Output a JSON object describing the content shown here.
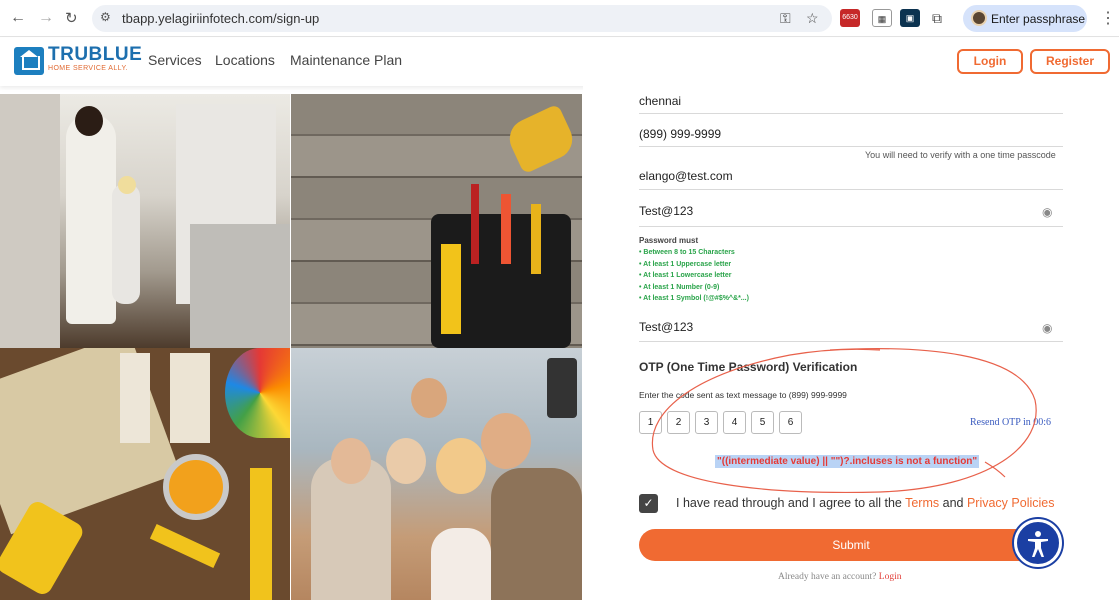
{
  "browser": {
    "url": "tbapp.yelagiriinfotech.com/sign-up",
    "profile_button": "Enter passphrase",
    "extension_badge": "6630"
  },
  "header": {
    "logo_name": "TRUBLUE",
    "logo_tagline": "HOME SERVICE ALLY.",
    "nav": [
      "Services",
      "Locations",
      "Maintenance Plan"
    ],
    "login_label": "Login",
    "register_label": "Register"
  },
  "form": {
    "city_value": "chennai",
    "phone_value": "(899) 999-9999",
    "phone_hint": "You will need to verify with a one time passcode",
    "email_value": "elango@test.com",
    "password_value": "Test@123",
    "password_rules_title": "Password must",
    "password_rules": [
      "• Between 8 to 15 Characters",
      "• At least 1 Uppercase letter",
      "• At least 1 Lowercase letter",
      "• At least 1 Number (0-9)",
      "• At least 1 Symbol (!@#$%^&*...)"
    ],
    "confirm_password_value": "Test@123",
    "otp_title": "OTP (One Time Password) Verification",
    "otp_subtitle": "Enter the code sent as text message to (899) 999-9999",
    "otp_digits": [
      "1",
      "2",
      "3",
      "4",
      "5",
      "6"
    ],
    "resend_label": "Resend OTP in 00:6",
    "error_message": "\"((intermediate value) || \"\")?.incluses is not a function\"",
    "agree_prefix": "I have read through and I agree to all the ",
    "terms_label": "Terms",
    "and_label": " and ",
    "privacy_label": "Privacy Policies",
    "submit_label": "Submit",
    "already_text": "Already have an account? ",
    "already_login": "Login"
  },
  "colors": {
    "brand_orange": "#f06a32",
    "brand_blue": "#1d6fae",
    "rule_green": "#2aa44a",
    "error_red": "#e53935"
  },
  "icons": [
    "back-icon",
    "forward-icon",
    "reload-icon",
    "site-settings-icon",
    "key-icon",
    "star-icon",
    "puzzle-icon",
    "eye-icon",
    "check-icon",
    "accessibility-icon",
    "kebab-menu-icon"
  ]
}
